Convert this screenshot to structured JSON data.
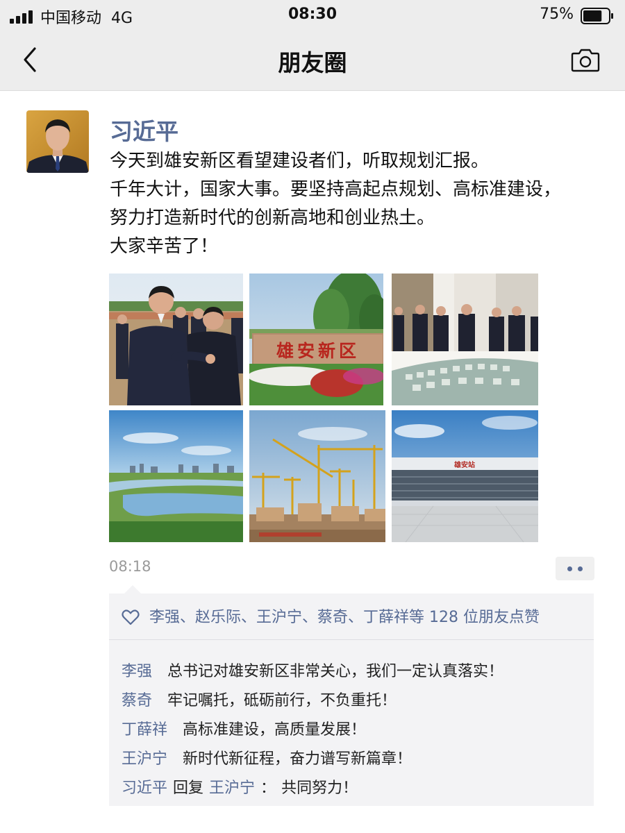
{
  "status_bar": {
    "carrier": "中国移动",
    "network": "4G",
    "time": "08:30",
    "battery": "75%",
    "battery_level": 0.75
  },
  "nav": {
    "title": "朋友圈",
    "back_icon": "back-arrow-icon",
    "camera_icon": "camera-icon"
  },
  "post": {
    "author": "习近平",
    "content_lines": [
      "今天到雄安新区看望建设者们，听取规划汇报。",
      "千年大计，国家大事。要坚持高起点规划、高标准建设，",
      "努力打造新时代的创新高地和创业热土。",
      "大家辛苦了！"
    ],
    "photos": [
      {
        "label": ""
      },
      {
        "label": "雄安新区"
      },
      {
        "label": ""
      },
      {
        "label": ""
      },
      {
        "label": ""
      },
      {
        "label": "雄安站"
      }
    ],
    "time": "08:18",
    "likes_text": "李强、赵乐际、王沪宁、蔡奇、丁薛祥等 128 位朋友点赞",
    "comments": [
      {
        "name": "李强",
        "text": "总书记对雄安新区非常关心，我们一定认真落实！"
      },
      {
        "name": "蔡奇",
        "text": "牢记嘱托，砥砺前行，不负重托！"
      },
      {
        "name": "丁薛祥",
        "text": "高标准建设，高质量发展！"
      },
      {
        "name": "王沪宁",
        "text": "新时代新征程，奋力谱写新篇章！"
      }
    ],
    "reply": {
      "name": "习近平",
      "verb": "回复",
      "target": "王沪宁",
      "separator": "：",
      "text": "共同努力！"
    }
  },
  "colors": {
    "link_blue": "#576b95",
    "nav_bg": "#ededed",
    "panel_bg": "#f3f3f5"
  }
}
